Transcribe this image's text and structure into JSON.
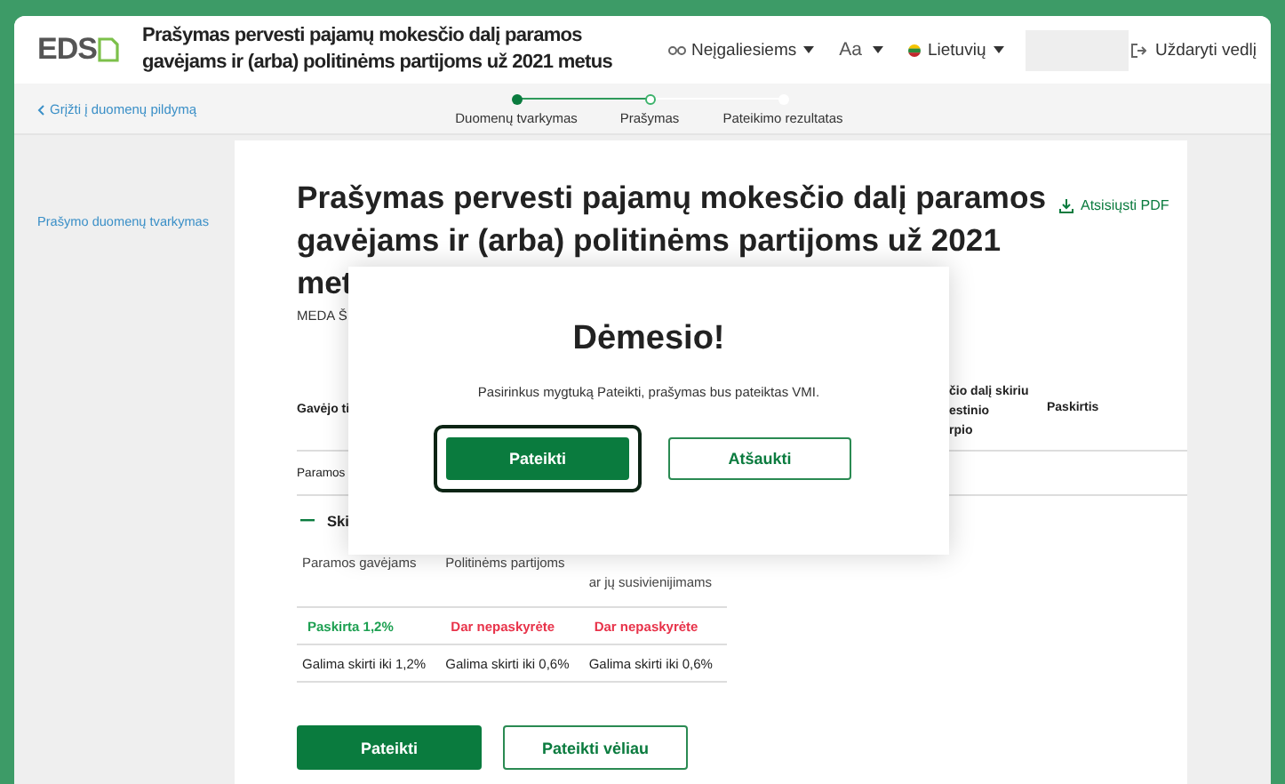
{
  "header": {
    "logo": "EDS",
    "title": "Prašymas pervesti pajamų mokesčio dalį paramos gavėjams ir (arba) politinėms partijoms už 2021 metus",
    "accessibility": "Neįgaliesiems",
    "font_size": "Aa",
    "language": "Lietuvių",
    "close": "Uždaryti vedlį"
  },
  "back_link": "Grįžti į duomenų pildymą",
  "steps": [
    {
      "label": "Duomenų tvarkymas",
      "completed": true,
      "selected": false
    },
    {
      "label": "Prašymas",
      "completed": false,
      "selected": true
    },
    {
      "label": "Pateikimo rezultatas",
      "completed": false,
      "selected": false
    }
  ],
  "sidebar": {
    "link": "Prašymo duomenų tvarkymas"
  },
  "content": {
    "title": "Prašymas pervesti pajamų mokesčio dalį paramos gavėjams ir (arba) politinėms partijoms už 2021 met",
    "pdf_link": "Atsisiųsti PDF",
    "person": "MEDA Š",
    "table": {
      "column_1": "Gavėjo ti",
      "column_3": "čio dalį skiriu\nestinio\nrpio",
      "column_4": "Paskirtis",
      "row_1": "Paramos"
    },
    "section": "Ski",
    "summary": {
      "columns": [
        "Paramos gavėjams",
        "Politinėms partijoms",
        "ar jų susivienijimams"
      ],
      "statuses": [
        {
          "text": "Paskirta 1,2%",
          "kind": "assigned"
        },
        {
          "text": "Dar nepaskyrėte",
          "kind": "unassigned"
        },
        {
          "text": "Dar nepaskyrėte",
          "kind": "unassigned"
        }
      ],
      "limits": [
        "Galima skirti iki 1,2%",
        "Galima skirti iki 0,6%",
        "Galima skirti iki 0,6%"
      ]
    },
    "buttons": [
      "Pateikti",
      "Pateikti vėliau"
    ]
  },
  "modal": {
    "title": "Dėmesio!",
    "message": "Pasirinkus mygtuką Pateikti, prašymas bus pateiktas VMI.",
    "buttons": [
      {
        "label": "Pateikti",
        "kind": "primary",
        "focused": true
      },
      {
        "label": "Atšaukti",
        "kind": "secondary",
        "focused": false
      }
    ]
  }
}
